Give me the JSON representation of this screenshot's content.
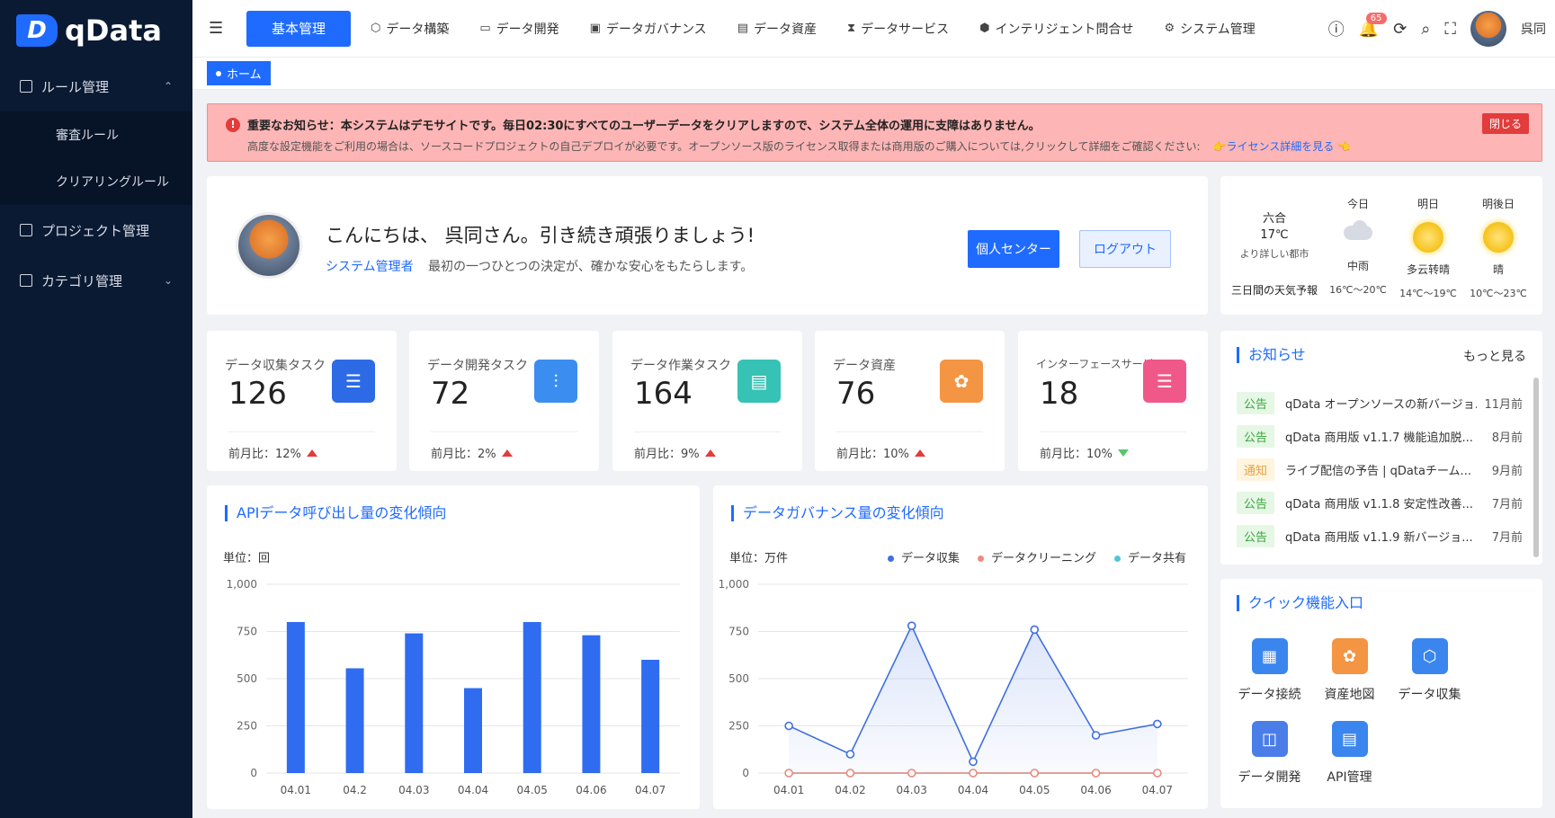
{
  "app": {
    "logo_letter": "D",
    "logo_text": "qData"
  },
  "sidebar": {
    "items": [
      {
        "label": "ルール管理",
        "chevron": "⌃",
        "children": [
          {
            "label": "審査ルール"
          },
          {
            "label": "クリアリングルール"
          }
        ]
      },
      {
        "label": "プロジェクト管理"
      },
      {
        "label": "カテゴリ管理",
        "chevron": "⌄"
      }
    ]
  },
  "header": {
    "main_button": "基本管理",
    "nav": [
      {
        "label": "データ構築",
        "icon": "cube-icon"
      },
      {
        "label": "データ開発",
        "icon": "db-icon"
      },
      {
        "label": "データガバナンス",
        "icon": "shield-icon"
      },
      {
        "label": "データ資産",
        "icon": "asset-icon"
      },
      {
        "label": "データサービス",
        "icon": "hourglass-icon"
      },
      {
        "label": "インテリジェント問合せ",
        "icon": "ai-icon"
      },
      {
        "label": "システム管理",
        "icon": "gear-icon"
      }
    ],
    "notif_count": "65",
    "user_name": "呉同"
  },
  "tabs": {
    "home": "ホーム"
  },
  "notice": {
    "title": "重要なお知らせ：本システムはデモサイトです。毎日02:30にすべてのユーザーデータをクリアしますので、システム全体の運用に支障はありません。",
    "body": "高度な設定機能をご利用の場合は、ソースコードプロジェクトの自己デプロイが必要です。オープンソース版のライセンス取得または商用版のご購入については,クリックして詳細をご確認ください:",
    "link": "👉ライセンス詳細を見る 👈",
    "close": "閉じる"
  },
  "welcome": {
    "greeting": "こんにちは、 呉同さん。引き続き頑張りましょう!",
    "role": "システム管理者",
    "motto": "最初の一つひとつの決定が、確かな安心をもたらします。",
    "btn_personal": "個人センター",
    "btn_logout": "ログアウト"
  },
  "weather": {
    "city": "六合",
    "temp": "17℃",
    "desc": "より詳しい都市",
    "forecast_label": "三日間の天気予報",
    "days": [
      {
        "day": "今日",
        "weather": "中雨",
        "range": "16℃～20℃",
        "icon": "rain-cloud-icon"
      },
      {
        "day": "明日",
        "weather": "多云转晴",
        "range": "14℃～19℃",
        "icon": "sun-icon"
      },
      {
        "day": "明後日",
        "weather": "晴",
        "range": "10℃～23℃",
        "icon": "sun-icon"
      }
    ]
  },
  "stats": [
    {
      "label": "データ収集タスク",
      "value": "126",
      "cmp": "前月比：12%",
      "trend": "up",
      "color": "#2d6be6"
    },
    {
      "label": "データ開発タスク",
      "value": "72",
      "cmp": "前月比：2%",
      "trend": "up",
      "color": "#3b8ef0"
    },
    {
      "label": "データ作業タスク",
      "value": "164",
      "cmp": "前月比：9%",
      "trend": "up",
      "color": "#36c2b4"
    },
    {
      "label": "データ資産",
      "value": "76",
      "cmp": "前月比：10%",
      "trend": "up",
      "color": "#f39543"
    },
    {
      "label": "インターフェースサービス",
      "value": "18",
      "cmp": "前月比：10%",
      "trend": "down",
      "color": "#f0588a"
    }
  ],
  "notices": {
    "title": "お知らせ",
    "more": "もっと見る",
    "items": [
      {
        "tag": "公告",
        "tag_color": "green",
        "text": "qData オープンソースの新バージョ...",
        "date": "11月前"
      },
      {
        "tag": "公告",
        "tag_color": "green",
        "text": "qData 商用版 v1.1.7 機能追加脱...",
        "date": "8月前"
      },
      {
        "tag": "通知",
        "tag_color": "yellow",
        "text": "ライブ配信の予告 | qDataチーム...",
        "date": "9月前"
      },
      {
        "tag": "公告",
        "tag_color": "green",
        "text": "qData 商用版 v1.1.8 安定性改善...",
        "date": "7月前"
      },
      {
        "tag": "公告",
        "tag_color": "green",
        "text": "qData 商用版 v1.1.9 新バージョ...",
        "date": "7月前"
      }
    ]
  },
  "quick": {
    "title": "クイック機能入口",
    "items": [
      {
        "label": "データ接続",
        "color": "#3a86ee"
      },
      {
        "label": "資産地図",
        "color": "#f39543"
      },
      {
        "label": "データ収集",
        "color": "#3a86ee"
      },
      {
        "label": "データ開発",
        "color": "#4a7de8"
      },
      {
        "label": "API管理",
        "color": "#3a86ee"
      }
    ]
  },
  "chart_data": [
    {
      "type": "bar",
      "title": "APIデータ呼び出し量の変化傾向",
      "unit_label": "単位：回",
      "categories": [
        "04.01",
        "04.2",
        "04.03",
        "04.04",
        "04.05",
        "04.06",
        "04.07"
      ],
      "values": [
        800,
        555,
        740,
        450,
        800,
        730,
        600
      ],
      "ylim": [
        0,
        1000
      ],
      "yticks": [
        "1,000",
        "750",
        "500",
        "250",
        "0"
      ],
      "color": "#2f6cf0"
    },
    {
      "type": "line",
      "title": "データガバナンス量の変化傾向",
      "unit_label": "単位：万件",
      "categories": [
        "04.01",
        "04.02",
        "04.03",
        "04.04",
        "04.05",
        "04.06",
        "04.07"
      ],
      "ylim": [
        0,
        1000
      ],
      "yticks": [
        "1,000",
        "750",
        "500",
        "250",
        "0"
      ],
      "series": [
        {
          "name": "データ収集",
          "values": [
            250,
            100,
            780,
            60,
            760,
            200,
            260
          ],
          "color": "#3f6fe0"
        },
        {
          "name": "データクリーニング",
          "values": [
            0,
            0,
            0,
            0,
            0,
            0,
            0
          ],
          "color": "#f08a7c"
        },
        {
          "name": "データ共有",
          "values": [
            0,
            0,
            0,
            0,
            0,
            0,
            0
          ],
          "color": "#54c6d6"
        }
      ]
    }
  ]
}
